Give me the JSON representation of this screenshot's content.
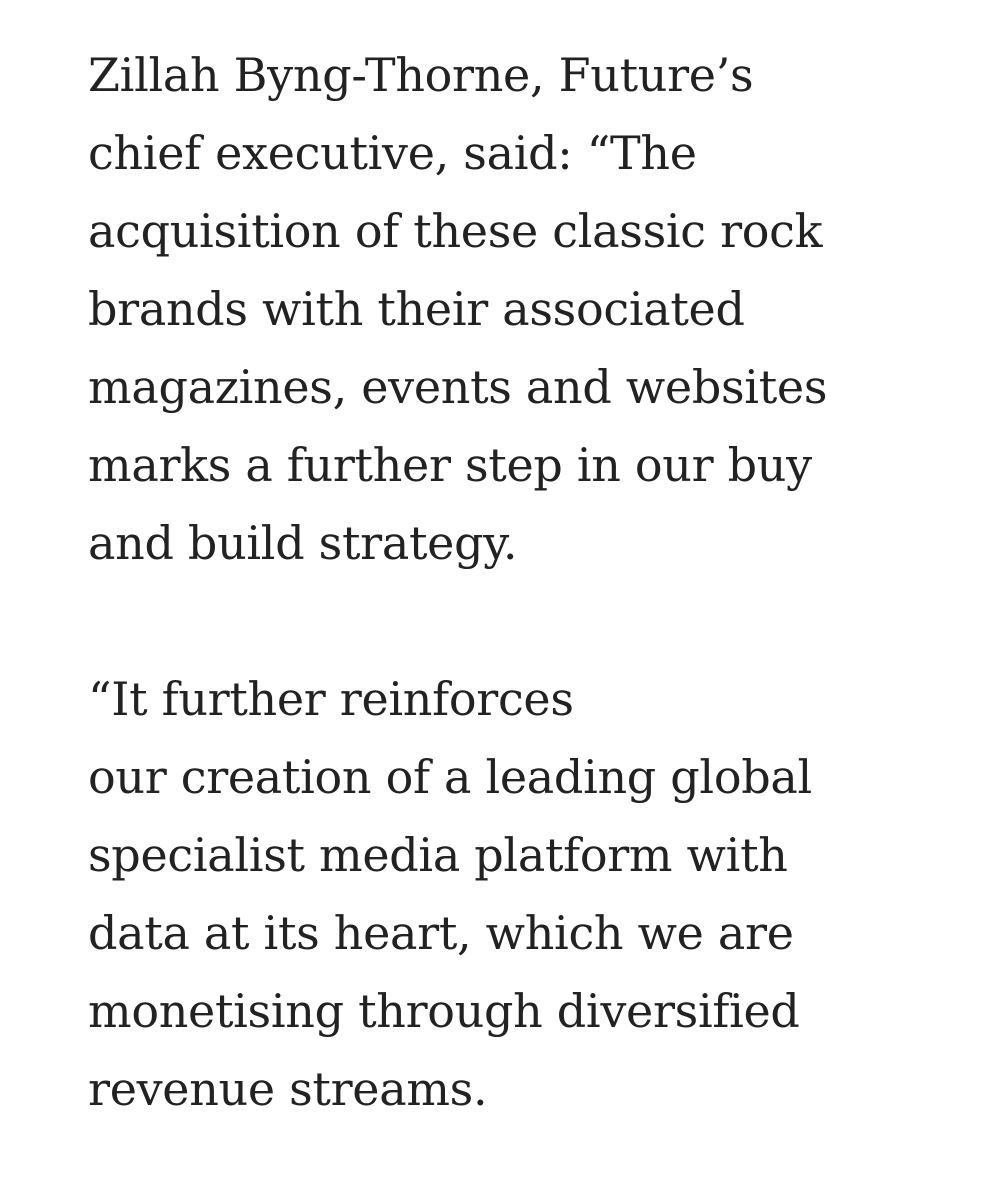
{
  "article": {
    "paragraphs": [
      {
        "lines": [
          "Zillah Byng-Thorne, Future’s",
          "chief executive, said: “The",
          "acquisition of these classic rock",
          "brands with their associated",
          "magazines, events and websites",
          "marks a further step in our buy",
          "and build strategy."
        ]
      },
      {
        "lines": [
          "“It further reinforces",
          "our creation of a leading global",
          "specialist media platform with",
          "data at its heart, which we are",
          "monetising through diversified",
          "revenue streams."
        ]
      }
    ]
  }
}
